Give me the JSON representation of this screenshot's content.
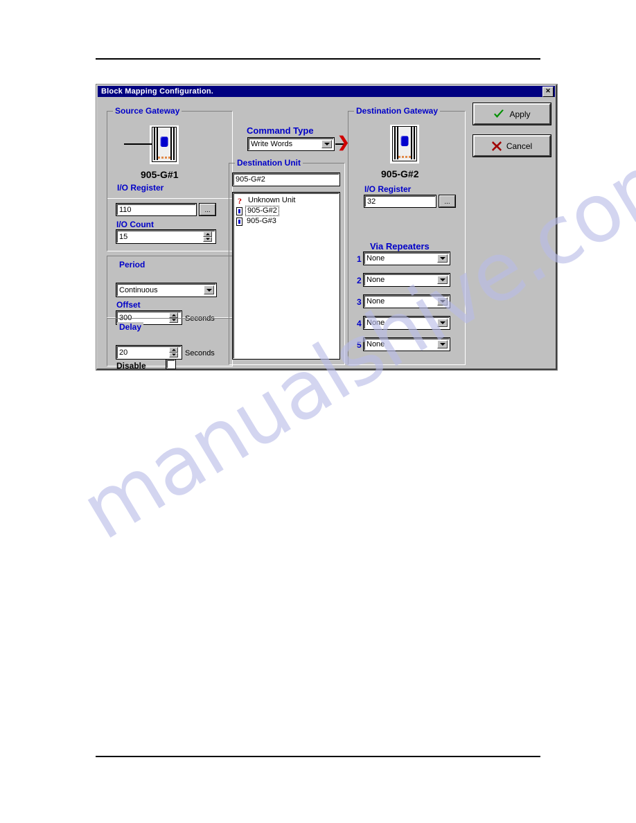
{
  "watermark": {
    "text": "manualshive.com",
    "color": "#b9bce8"
  },
  "dialog": {
    "title": "Block Mapping Configuration.",
    "close_icon": "close-icon",
    "close_label": "✕"
  },
  "source_gateway": {
    "legend": "Source Gateway",
    "device_icon": "gateway-device-icon",
    "device_name": "905-G#1",
    "io_register_label": "I/O Register",
    "io_register_value": "110",
    "io_register_browse_label": "...",
    "io_count_label": "I/O Count",
    "io_count_value": "15"
  },
  "period": {
    "legend": "Period",
    "value": "Continuous",
    "offset_label": "Offset",
    "offset_value": "300",
    "offset_units": "Seconds"
  },
  "delay": {
    "legend": "Delay",
    "value": "20",
    "units": "Seconds",
    "disable_label": "Disable",
    "disable_checked": false
  },
  "command": {
    "label": "Command Type",
    "value": "Write Words",
    "arrow_icon": "flow-arrow-icon",
    "arrow_glyph": "❯"
  },
  "destination_unit": {
    "legend": "Destination Unit",
    "selected_value": "905-G#2",
    "items": [
      {
        "label": "Unknown Unit",
        "icon": "unknown-unit-icon",
        "selected": false
      },
      {
        "label": "905-G#2",
        "icon": "unit-device-icon",
        "selected": true
      },
      {
        "label": "905-G#3",
        "icon": "unit-device-icon",
        "selected": false
      }
    ]
  },
  "destination_gateway": {
    "legend": "Destination Gateway",
    "device_icon": "gateway-device-icon",
    "device_name": "905-G#2",
    "io_register_label": "I/O Register",
    "io_register_value": "32",
    "io_register_browse_label": "...",
    "via_repeaters_label": "Via Repeaters",
    "repeaters": [
      {
        "num": "1",
        "value": "None"
      },
      {
        "num": "2",
        "value": "None"
      },
      {
        "num": "3",
        "value": "None"
      },
      {
        "num": "4",
        "value": "None"
      },
      {
        "num": "5",
        "value": "None"
      }
    ]
  },
  "actions": {
    "apply_label": "Apply",
    "apply_icon": "check-icon",
    "cancel_label": "Cancel",
    "cancel_icon": "x-icon"
  }
}
